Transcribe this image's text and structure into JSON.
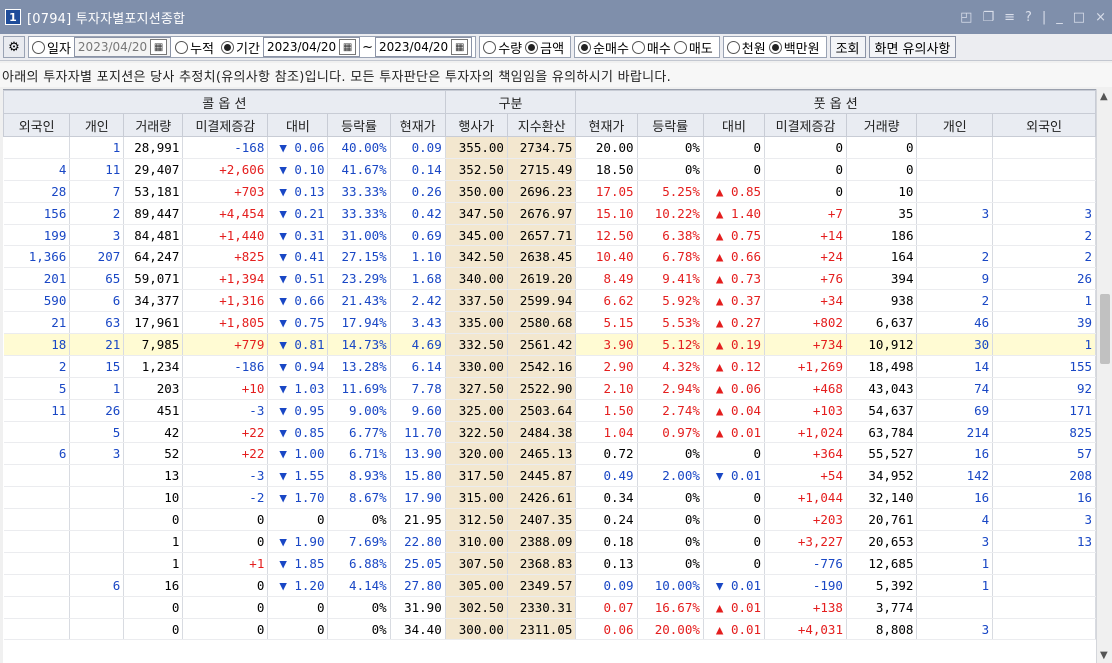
{
  "window": {
    "number": "1",
    "title": "[0794] 투자자별포지션종합",
    "controls": [
      "◰",
      "❐",
      "≡",
      "?",
      "|",
      "_",
      "□",
      "×"
    ]
  },
  "toolbar": {
    "day_label": "일자",
    "day_date": "2023/04/20",
    "cumulative_label": "누적",
    "period_label": "기간",
    "from_date": "2023/04/20",
    "to_date": "2023/04/20",
    "tilde": "~",
    "qty_label": "수량",
    "amount_label": "금액",
    "netbuy_label": "순매수",
    "buy_label": "매수",
    "sell_label": "매도",
    "won_label": "천원",
    "million_label": "백만원",
    "query_button": "조회",
    "notes_button": "화면 유의사항"
  },
  "notice": "아래의 투자자별 포지션은 당사 추정치(유의사항 참조)입니다. 모든 투자판단은 투자자의 책임임을 유의하시기 바랍니다.",
  "grid": {
    "group_headers": {
      "call": "콜 옵 션",
      "mid": "구분",
      "put": "풋 옵 션"
    },
    "columns": [
      "외국인",
      "개인",
      "거래량",
      "미결제증감",
      "대비",
      "등락률",
      "현재가",
      "행사가",
      "지수환산",
      "현재가",
      "등락률",
      "대비",
      "미결제증감",
      "거래량",
      "개인",
      "외국인"
    ],
    "rows": [
      [
        "",
        "1",
        "28,991",
        "-168",
        "▼ 0.06",
        "40.00%",
        "0.09",
        "355.00",
        "2734.75",
        "20.00",
        "0%",
        "0",
        "0",
        "0",
        "",
        ""
      ],
      [
        "4",
        "11",
        "29,407",
        "+2,606",
        "▼ 0.10",
        "41.67%",
        "0.14",
        "352.50",
        "2715.49",
        "18.50",
        "0%",
        "0",
        "0",
        "0",
        "",
        ""
      ],
      [
        "28",
        "7",
        "53,181",
        "+703",
        "▼ 0.13",
        "33.33%",
        "0.26",
        "350.00",
        "2696.23",
        "17.05",
        "5.25%",
        "▲ 0.85",
        "0",
        "10",
        "",
        ""
      ],
      [
        "156",
        "2",
        "89,447",
        "+4,454",
        "▼ 0.21",
        "33.33%",
        "0.42",
        "347.50",
        "2676.97",
        "15.10",
        "10.22%",
        "▲ 1.40",
        "+7",
        "35",
        "3",
        "3"
      ],
      [
        "199",
        "3",
        "84,481",
        "+1,440",
        "▼ 0.31",
        "31.00%",
        "0.69",
        "345.00",
        "2657.71",
        "12.50",
        "6.38%",
        "▲ 0.75",
        "+14",
        "186",
        "",
        "2"
      ],
      [
        "1,366",
        "207",
        "64,247",
        "+825",
        "▼ 0.41",
        "27.15%",
        "1.10",
        "342.50",
        "2638.45",
        "10.40",
        "6.78%",
        "▲ 0.66",
        "+24",
        "164",
        "2",
        "2"
      ],
      [
        "201",
        "65",
        "59,071",
        "+1,394",
        "▼ 0.51",
        "23.29%",
        "1.68",
        "340.00",
        "2619.20",
        "8.49",
        "9.41%",
        "▲ 0.73",
        "+76",
        "394",
        "9",
        "26"
      ],
      [
        "590",
        "6",
        "34,377",
        "+1,316",
        "▼ 0.66",
        "21.43%",
        "2.42",
        "337.50",
        "2599.94",
        "6.62",
        "5.92%",
        "▲ 0.37",
        "+34",
        "938",
        "2",
        "1"
      ],
      [
        "21",
        "63",
        "17,961",
        "+1,805",
        "▼ 0.75",
        "17.94%",
        "3.43",
        "335.00",
        "2580.68",
        "5.15",
        "5.53%",
        "▲ 0.27",
        "+802",
        "6,637",
        "46",
        "39"
      ],
      [
        "18",
        "21",
        "7,985",
        "+779",
        "▼ 0.81",
        "14.73%",
        "4.69",
        "332.50",
        "2561.42",
        "3.90",
        "5.12%",
        "▲ 0.19",
        "+734",
        "10,912",
        "30",
        "1"
      ],
      [
        "2",
        "15",
        "1,234",
        "-186",
        "▼ 0.94",
        "13.28%",
        "6.14",
        "330.00",
        "2542.16",
        "2.90",
        "4.32%",
        "▲ 0.12",
        "+1,269",
        "18,498",
        "14",
        "155"
      ],
      [
        "5",
        "1",
        "203",
        "+10",
        "▼ 1.03",
        "11.69%",
        "7.78",
        "327.50",
        "2522.90",
        "2.10",
        "2.94%",
        "▲ 0.06",
        "+468",
        "43,043",
        "74",
        "92"
      ],
      [
        "11",
        "26",
        "451",
        "-3",
        "▼ 0.95",
        "9.00%",
        "9.60",
        "325.00",
        "2503.64",
        "1.50",
        "2.74%",
        "▲ 0.04",
        "+103",
        "54,637",
        "69",
        "171"
      ],
      [
        "",
        "5",
        "42",
        "+22",
        "▼ 0.85",
        "6.77%",
        "11.70",
        "322.50",
        "2484.38",
        "1.04",
        "0.97%",
        "▲ 0.01",
        "+1,024",
        "63,784",
        "214",
        "825"
      ],
      [
        "6",
        "3",
        "52",
        "+22",
        "▼ 1.00",
        "6.71%",
        "13.90",
        "320.00",
        "2465.13",
        "0.72",
        "0%",
        "0",
        "+364",
        "55,527",
        "16",
        "57"
      ],
      [
        "",
        "",
        "13",
        "-3",
        "▼ 1.55",
        "8.93%",
        "15.80",
        "317.50",
        "2445.87",
        "0.49",
        "2.00%",
        "▼ 0.01",
        "+54",
        "34,952",
        "142",
        "208"
      ],
      [
        "",
        "",
        "10",
        "-2",
        "▼ 1.70",
        "8.67%",
        "17.90",
        "315.00",
        "2426.61",
        "0.34",
        "0%",
        "0",
        "+1,044",
        "32,140",
        "16",
        "16"
      ],
      [
        "",
        "",
        "0",
        "0",
        "0",
        "0%",
        "21.95",
        "312.50",
        "2407.35",
        "0.24",
        "0%",
        "0",
        "+203",
        "20,761",
        "4",
        "3"
      ],
      [
        "",
        "",
        "1",
        "0",
        "▼ 1.90",
        "7.69%",
        "22.80",
        "310.00",
        "2388.09",
        "0.18",
        "0%",
        "0",
        "+3,227",
        "20,653",
        "3",
        "13"
      ],
      [
        "",
        "",
        "1",
        "+1",
        "▼ 1.85",
        "6.88%",
        "25.05",
        "307.50",
        "2368.83",
        "0.13",
        "0%",
        "0",
        "-776",
        "12,685",
        "1",
        ""
      ],
      [
        "",
        "6",
        "16",
        "0",
        "▼ 1.20",
        "4.14%",
        "27.80",
        "305.00",
        "2349.57",
        "0.09",
        "10.00%",
        "▼ 0.01",
        "-190",
        "5,392",
        "1",
        ""
      ],
      [
        "",
        "",
        "0",
        "0",
        "0",
        "0%",
        "31.90",
        "302.50",
        "2330.31",
        "0.07",
        "16.67%",
        "▲ 0.01",
        "+138",
        "3,774",
        "",
        ""
      ],
      [
        "",
        "",
        "0",
        "0",
        "0",
        "0%",
        "34.40",
        "300.00",
        "2311.05",
        "0.06",
        "20.00%",
        "▲ 0.01",
        "+4,031",
        "8,808",
        "3",
        ""
      ]
    ],
    "highlight_row": 9
  },
  "colors": {
    "blue": "#1947c5",
    "red": "#e41e1e",
    "mid_bg": "#f3e7cf",
    "highlight_bg": "#fffbd3"
  },
  "scrollbar": {
    "up": "▲",
    "down": "▼"
  }
}
